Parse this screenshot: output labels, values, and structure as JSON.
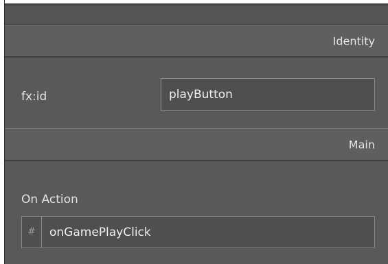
{
  "sections": {
    "identity": {
      "title": "Identity",
      "fx_id": {
        "label": "fx:id",
        "value": "playButton"
      }
    },
    "main": {
      "title": "Main",
      "on_action": {
        "label": "On Action",
        "prefix_symbol": "#",
        "value": "onGamePlayClick"
      }
    }
  }
}
